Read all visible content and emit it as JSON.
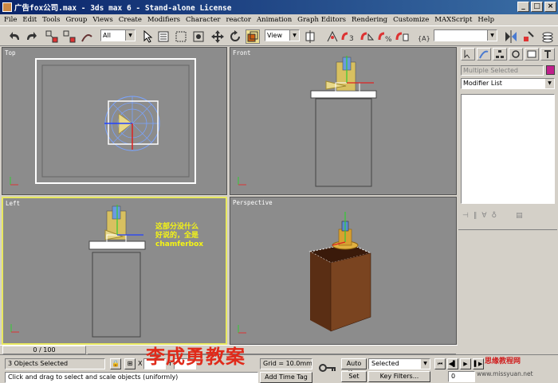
{
  "window": {
    "title": "广告fox公司.max - 3ds max 6 - Stand-alone License",
    "controls": [
      "_",
      "□",
      "×"
    ]
  },
  "menu": [
    "File",
    "Edit",
    "Tools",
    "Group",
    "Views",
    "Create",
    "Modifiers",
    "Character",
    "reactor",
    "Animation",
    "Graph Editors",
    "Rendering",
    "Customize",
    "MAXScript",
    "Help"
  ],
  "toolbar": {
    "selection_filter": "All",
    "ref_coord": "View",
    "named_selection": ""
  },
  "viewports": {
    "top": "Top",
    "front": "Front",
    "left": "Left",
    "perspective": "Perspective"
  },
  "annotation": {
    "line1": "这部分没什么",
    "line2": "好说的，全是",
    "line3": "chamferbox"
  },
  "command_panel": {
    "object_name_placeholder": "Multiple Selected",
    "modifier_list": "Modifier List",
    "swatch_color": "#c0208c"
  },
  "timeline": {
    "slider": "0 / 100"
  },
  "status": {
    "selected": "3 Objects Selected",
    "prompt": "Click and drag to select and scale objects (uniformly)",
    "x_label": "X",
    "y_label": "Y",
    "x_value": "",
    "y_value": "",
    "grid": "Grid = 10.0mm",
    "add_time_tag": "Add Time Tag",
    "auto_key": "Auto Key",
    "set_key": "Set Key",
    "key_mode": "Selected",
    "key_filters": "Key Filters...",
    "frame": "0"
  },
  "watermark": {
    "author": "李成勇教案",
    "site": "思缘教程网",
    "url": "www.missyuan.net"
  }
}
